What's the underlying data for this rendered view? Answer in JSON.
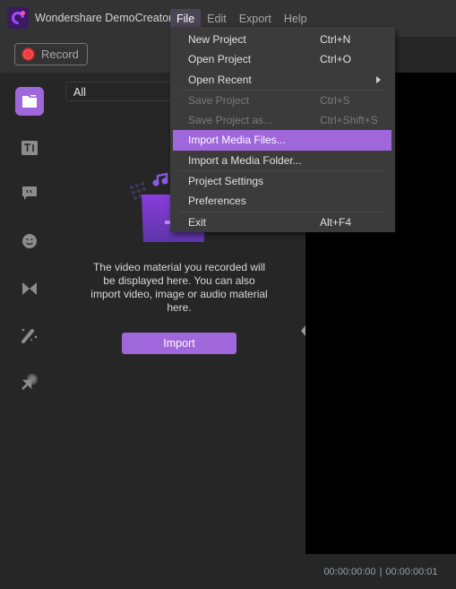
{
  "app": {
    "title": "Wondershare DemoCreator",
    "logo_icon": "democreator-logo-icon"
  },
  "menubar": {
    "items": [
      {
        "label": "File",
        "active": true
      },
      {
        "label": "Edit",
        "active": false
      },
      {
        "label": "Export",
        "active": false
      },
      {
        "label": "Help",
        "active": false
      }
    ]
  },
  "toolbar": {
    "record_label": "Record",
    "record_icon": "record-dot-icon"
  },
  "rail": {
    "items": [
      {
        "name": "media",
        "icon": "folder-icon",
        "active": true
      },
      {
        "name": "text",
        "icon": "text-title-icon",
        "active": false
      },
      {
        "name": "annotations",
        "icon": "speech-bubble-icon",
        "active": false
      },
      {
        "name": "stickers",
        "icon": "sticker-face-icon",
        "active": false
      },
      {
        "name": "transitions",
        "icon": "bowtie-transition-icon",
        "active": false
      },
      {
        "name": "effects",
        "icon": "magic-wand-icon",
        "active": false
      },
      {
        "name": "cursor-effects",
        "icon": "cursor-click-icon",
        "active": false
      }
    ]
  },
  "library": {
    "filter_value": "All",
    "empty_message": "The video material you recorded will be displayed here. You can also import video, image or audio material here.",
    "import_label": "Import"
  },
  "preview": {
    "current_time": "00:00:00:00",
    "separator": "|",
    "total_time": "00:00:00:01"
  },
  "file_menu": {
    "items": [
      {
        "label": "New Project",
        "shortcut": "Ctrl+N",
        "disabled": false
      },
      {
        "label": "Open Project",
        "shortcut": "Ctrl+O",
        "disabled": false
      },
      {
        "label": "Open Recent",
        "shortcut": "",
        "submenu": true,
        "disabled": false
      },
      {
        "label": "Save Project",
        "shortcut": "Ctrl+S",
        "disabled": true
      },
      {
        "label": "Save Project as...",
        "shortcut": "Ctrl+Shift+S",
        "disabled": true
      },
      {
        "label": "Import Media Files...",
        "shortcut": "",
        "highlighted": true,
        "disabled": false
      },
      {
        "label": "Import a Media Folder...",
        "shortcut": "",
        "disabled": false
      },
      {
        "label": "Project Settings",
        "shortcut": "",
        "disabled": false
      },
      {
        "label": "Preferences",
        "shortcut": "",
        "disabled": false
      },
      {
        "label": "Exit",
        "shortcut": "Alt+F4",
        "disabled": false
      }
    ]
  },
  "colors": {
    "accent": "#a066dc",
    "record": "#f03a3f",
    "background": "#262626",
    "titlebar": "#333333",
    "menu_bg": "#3b3b3b"
  }
}
